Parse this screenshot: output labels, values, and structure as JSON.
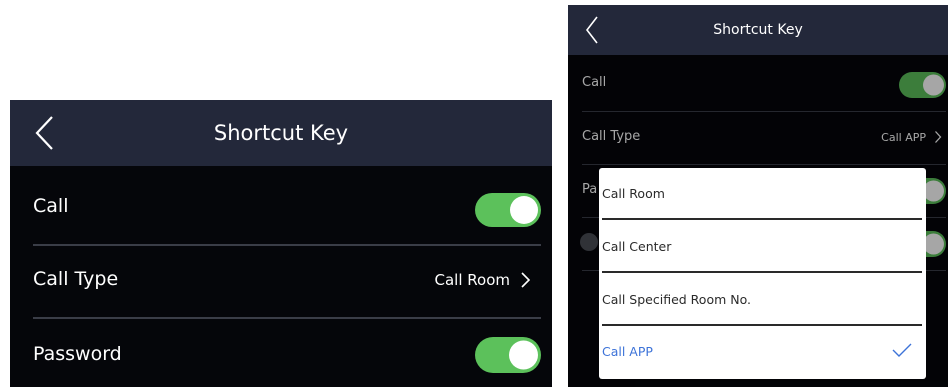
{
  "left_screen": {
    "title": "Shortcut Key",
    "rows": [
      {
        "label": "Call",
        "toggle_on": true
      },
      {
        "label": "Call Type",
        "value": "Call Room"
      },
      {
        "label": "Password",
        "toggle_on": true
      }
    ]
  },
  "right_screen": {
    "title": "Shortcut Key",
    "rows": [
      {
        "label": "Call",
        "toggle_on": true
      },
      {
        "label": "Call Type",
        "value": "Call APP"
      },
      {
        "label": "Pa"
      }
    ],
    "dropdown": {
      "options": [
        "Call Room",
        "Call Center",
        "Call Specified Room No.",
        "Call APP"
      ],
      "selected": "Call APP"
    }
  },
  "colors": {
    "header_bg": "#23283a",
    "screen_bg": "#05060a",
    "toggle_on": "#5cc15b",
    "selected_text": "#3d73d8"
  },
  "icons": [
    "back-arrow-icon",
    "chevron-right-icon",
    "checkmark-icon"
  ]
}
